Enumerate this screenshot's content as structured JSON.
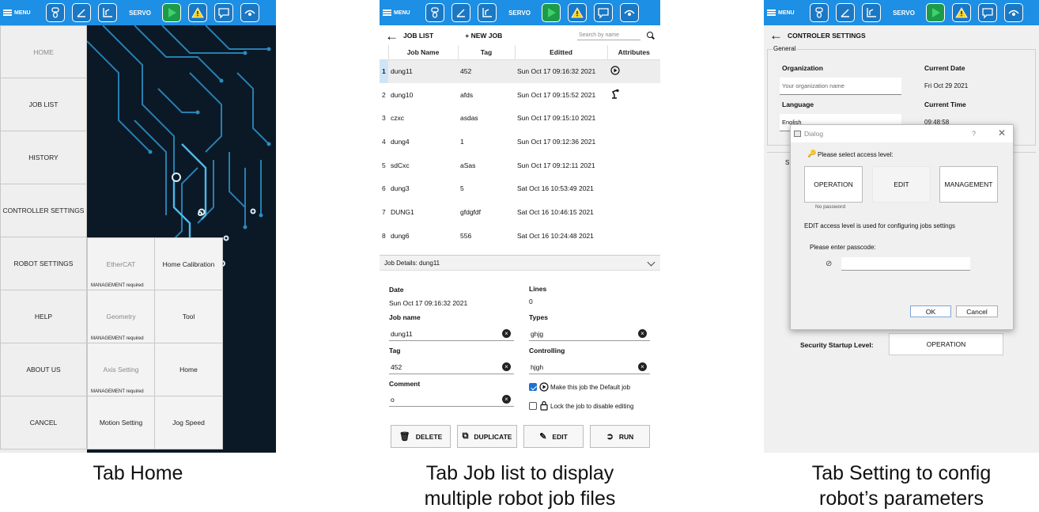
{
  "toolbar": {
    "menu_label": "MENU",
    "servo_label": "SERVO"
  },
  "home": {
    "buttons": [
      "HOME",
      "JOB LIST",
      "HISTORY",
      "CONTROLLER SETTINGS",
      "ROBOT SETTINGS",
      "HELP",
      "ABOUT US",
      "CANCEL"
    ],
    "submenu": [
      {
        "label": "EtherCAT",
        "note": "MANAGEMENT required"
      },
      {
        "label": "Home Calibration",
        "note": ""
      },
      {
        "label": "Geometry",
        "note": "MANAGEMENT required"
      },
      {
        "label": "Tool",
        "note": ""
      },
      {
        "label": "Axis Setting",
        "note": "MANAGEMENT required"
      },
      {
        "label": "Home",
        "note": ""
      },
      {
        "label": "Motion Setting",
        "note": ""
      },
      {
        "label": "Jog Speed",
        "note": ""
      }
    ]
  },
  "joblist": {
    "title": "JOB LIST",
    "new_job": "+ NEW JOB",
    "search_placeholder": "Search by name",
    "columns": [
      "Job Name",
      "Tag",
      "Editted",
      "Attributes"
    ],
    "rows": [
      {
        "idx": "1",
        "name": "dung11",
        "tag": "452",
        "edited": "Sun Oct 17 09:16:32 2021",
        "attr": "play-icon"
      },
      {
        "idx": "2",
        "name": "dung10",
        "tag": "afds",
        "edited": "Sun Oct 17 09:15:52 2021",
        "attr": "robot-icon"
      },
      {
        "idx": "3",
        "name": "czxc",
        "tag": "asdas",
        "edited": "Sun Oct 17 09:15:10 2021",
        "attr": ""
      },
      {
        "idx": "4",
        "name": "dung4",
        "tag": "1",
        "edited": "Sun Oct 17 09:12:36 2021",
        "attr": ""
      },
      {
        "idx": "5",
        "name": "sdCxc",
        "tag": "aSas",
        "edited": "Sun Oct 17 09:12:11 2021",
        "attr": ""
      },
      {
        "idx": "6",
        "name": "dung3",
        "tag": "5",
        "edited": "Sat Oct 16 10:53:49 2021",
        "attr": ""
      },
      {
        "idx": "7",
        "name": "DUNG1",
        "tag": "gfdgfdf",
        "edited": "Sat Oct 16 10:46:15 2021",
        "attr": ""
      },
      {
        "idx": "8",
        "name": "dung6",
        "tag": "556",
        "edited": "Sat Oct 16 10:24:48 2021",
        "attr": ""
      }
    ],
    "details": {
      "header": "Job Details:  dung11",
      "date_label": "Date",
      "date_value": "Sun Oct 17 09:16:32 2021",
      "lines_label": "Lines",
      "lines_value": "0",
      "jobname_label": "Job name",
      "jobname_value": "dung11",
      "types_label": "Types",
      "types_value": "ghjg",
      "tag_label": "Tag",
      "tag_value": "452",
      "controlling_label": "Controlling",
      "controlling_value": "hjgh",
      "comment_label": "Comment",
      "comment_value": "o",
      "default_label": "Make this job the Default job",
      "lock_label": "Lock the job to disable editing"
    },
    "actions": [
      "DELETE",
      "DUPLICATE",
      "EDIT",
      "RUN"
    ]
  },
  "settings": {
    "title": "CONTROLER SETTINGS",
    "general": "General",
    "organization_label": "Organization",
    "organization_placeholder": "Your organization name",
    "date_label": "Current Date",
    "date_value": "Fri Oct 29 2021",
    "language_label": "Language",
    "language_value": "English",
    "time_label": "Current Time",
    "time_value": "09:48:58",
    "side_letter": "S",
    "startup_label": "Security Startup Level:",
    "startup_value": "OPERATION",
    "dialog": {
      "title": "Dialog",
      "question": "?",
      "prompt": "Please select access level:",
      "levels": [
        "OPERATION",
        "EDIT",
        "MANAGEMENT"
      ],
      "no_password": "No password",
      "info": "EDIT access level is used for configuring jobs settings",
      "passcode_label": "Please enter passcode:",
      "ok": "OK",
      "cancel": "Cancel"
    }
  },
  "captions": {
    "home": "Tab Home",
    "joblist_1": "Tab Job list to display",
    "joblist_2": "multiple robot job files",
    "settings_1": "Tab Setting to config",
    "settings_2": "robot’s parameters"
  }
}
